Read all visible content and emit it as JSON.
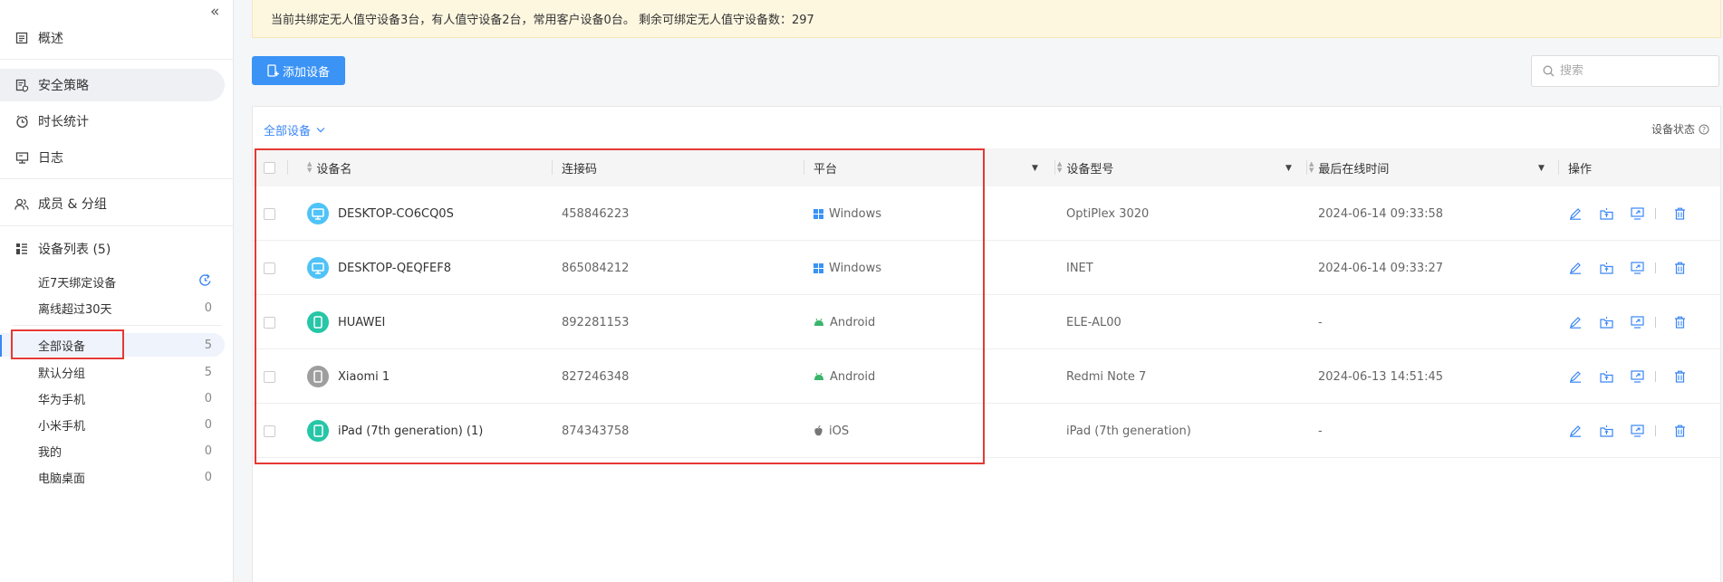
{
  "sidebar": {
    "nav": [
      {
        "label": "概述",
        "icon": "overview-icon"
      },
      {
        "label": "安全策略",
        "icon": "security-policy-icon"
      },
      {
        "label": "时长统计",
        "icon": "clock-icon"
      },
      {
        "label": "日志",
        "icon": "log-icon"
      },
      {
        "label": "成员 & 分组",
        "icon": "members-icon"
      },
      {
        "label": "设备列表 (5)",
        "icon": "device-list-icon"
      }
    ],
    "groups": [
      {
        "label": "近7天绑定设备",
        "count": ""
      },
      {
        "label": "离线超过30天",
        "count": "0"
      },
      {
        "label": "全部设备",
        "count": "5"
      },
      {
        "label": "默认分组",
        "count": "5"
      },
      {
        "label": "华为手机",
        "count": "0"
      },
      {
        "label": "小米手机",
        "count": "0"
      },
      {
        "label": "我的",
        "count": "0"
      },
      {
        "label": "电脑桌面",
        "count": "0"
      }
    ]
  },
  "banner": {
    "text": "当前共绑定无人值守设备3台，有人值守设备2台，常用客户设备0台。 剩余可绑定无人值守设备数：297"
  },
  "toolbar": {
    "add_label": "添加设备",
    "search_placeholder": "搜索"
  },
  "table": {
    "filter_label": "全部设备",
    "status_label": "设备状态",
    "columns": {
      "name": "设备名",
      "code": "连接码",
      "platform": "平台",
      "model": "设备型号",
      "last_online": "最后在线时间",
      "ops": "操作"
    },
    "rows": [
      {
        "name": "DESKTOP-CO6CQ0S",
        "code": "458846223",
        "platform": "Windows",
        "model": "OptiPlex 3020",
        "last_online": "2024-06-14 09:33:58",
        "icon": "desktop-icon",
        "color": "#4fc3f7"
      },
      {
        "name": "DESKTOP-QEQFEF8",
        "code": "865084212",
        "platform": "Windows",
        "model": "INET",
        "last_online": "2024-06-14 09:33:27",
        "icon": "desktop-icon",
        "color": "#4fc3f7"
      },
      {
        "name": "HUAWEI",
        "code": "892281153",
        "platform": "Android",
        "model": "ELE-AL00",
        "last_online": "-",
        "icon": "phone-icon",
        "color": "#26c6a6"
      },
      {
        "name": "Xiaomi 1",
        "code": "827246348",
        "platform": "Android",
        "model": "Redmi Note 7",
        "last_online": "2024-06-13 14:51:45",
        "icon": "phone-icon",
        "color": "#9e9e9e"
      },
      {
        "name": "iPad (7th generation) (1)",
        "code": "874343758",
        "platform": "iOS",
        "model": "iPad (7th generation)",
        "last_online": "-",
        "icon": "tablet-icon",
        "color": "#26c6a6"
      }
    ]
  },
  "colors": {
    "accent": "#3a93f5",
    "highlight": "#e53935",
    "banner_bg": "#fdf7e0"
  }
}
